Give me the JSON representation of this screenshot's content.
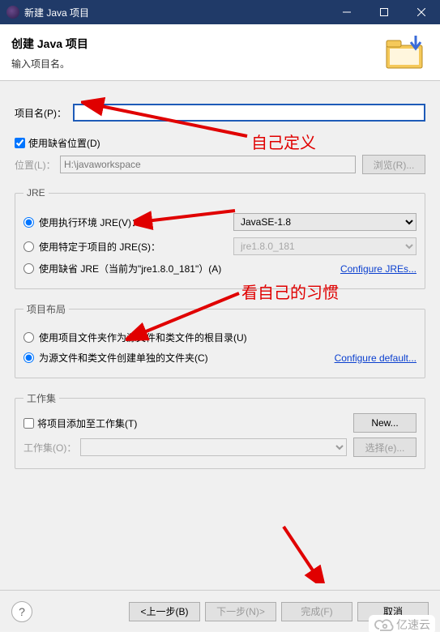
{
  "titlebar": {
    "title": "新建 Java 项目"
  },
  "banner": {
    "heading": "创建 Java 项目",
    "subtitle": "输入项目名。"
  },
  "project": {
    "name_label": "项目名(P)：",
    "name_value": "",
    "use_default_location_label": "使用缺省位置(D)",
    "use_default_location_checked": true,
    "location_label": "位置(L)：",
    "location_value": "H:\\javaworkspace",
    "browse_label": "浏览(R)..."
  },
  "jre": {
    "legend": "JRE",
    "option_env_label": "使用执行环境 JRE(V)：",
    "option_env_selected": true,
    "env_value": "JavaSE-1.8",
    "option_specific_label": "使用特定于项目的 JRE(S)：",
    "option_specific_selected": false,
    "specific_value": "jre1.8.0_181",
    "option_default_label": "使用缺省 JRE（当前为\"jre1.8.0_181\"）(A)",
    "option_default_selected": false,
    "configure_link": "Configure JREs..."
  },
  "layout": {
    "legend": "项目布局",
    "option_root_label": "使用项目文件夹作为源文件和类文件的根目录(U)",
    "option_root_selected": false,
    "option_separate_label": "为源文件和类文件创建单独的文件夹(C)",
    "option_separate_selected": true,
    "configure_link": "Configure default..."
  },
  "workingset": {
    "legend": "工作集",
    "add_label": "将项目添加至工作集(T)",
    "add_checked": false,
    "new_label": "New...",
    "sets_label": "工作集(O)：",
    "select_label": "选择(e)..."
  },
  "buttons": {
    "back": "<上一步(B)",
    "next": "下一步(N)>",
    "finish": "完成(F)",
    "cancel": "取消"
  },
  "annotations": {
    "a1": "自己定义",
    "a2": "看自己的习惯"
  },
  "watermark": "亿速云"
}
